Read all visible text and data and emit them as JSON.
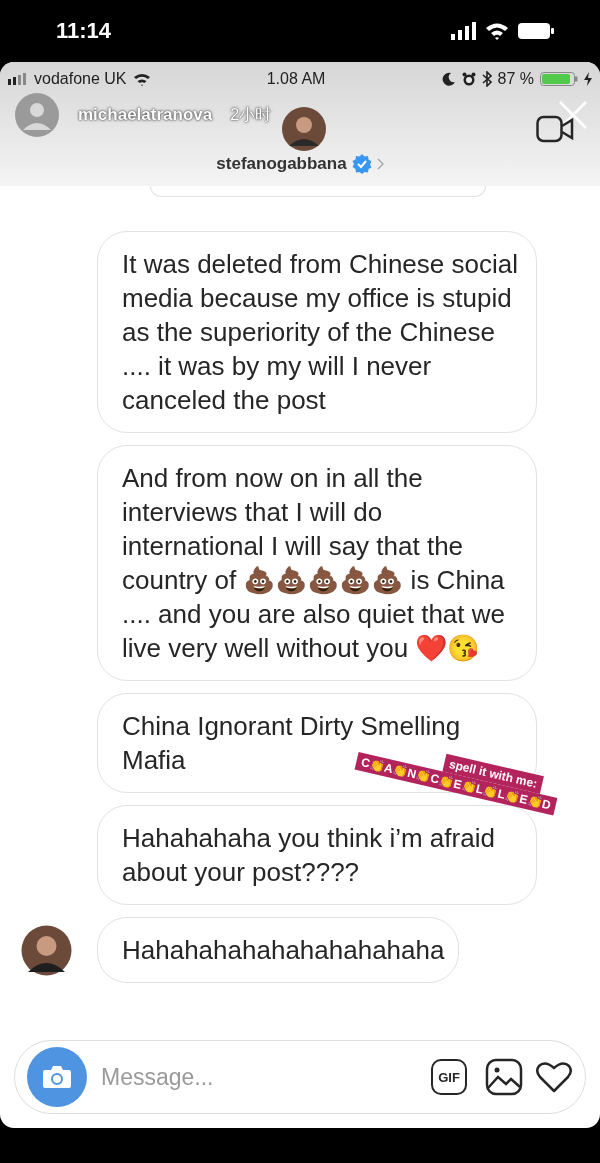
{
  "phone_status": {
    "time": "11:14"
  },
  "story_status": {
    "carrier": "vodafone UK",
    "time": "1.08 AM",
    "battery": "87 %"
  },
  "story_header": {
    "username": "michaelatranova",
    "age": "2小时"
  },
  "chat": {
    "username": "stefanogabbana",
    "verified": true
  },
  "messages": [
    {
      "text": "It was deleted from Chinese social media because my office is stupid as the superiority of the Chinese .... it was by my will I never canceled the post",
      "avatar": false
    },
    {
      "text": "And from now on in all the interviews that I will do international I will say that the country of 💩💩💩💩💩 is China .... and you are also quiet that we live very well without you ❤️😘",
      "avatar": false
    },
    {
      "text": "China Ignorant Dirty Smelling Mafia",
      "avatar": false
    },
    {
      "text": "Hahahahaha you think i’m afraid about your post????",
      "avatar": false
    },
    {
      "text": "Hahahahahahahahahahaha",
      "avatar": true
    }
  ],
  "sticker": {
    "line_1": "spell it with me:",
    "line_2": "C👏A👏N👏C👏E👏L👏L👏E👏D"
  },
  "composer": {
    "placeholder": "Message...",
    "gif_label": "GIF"
  }
}
